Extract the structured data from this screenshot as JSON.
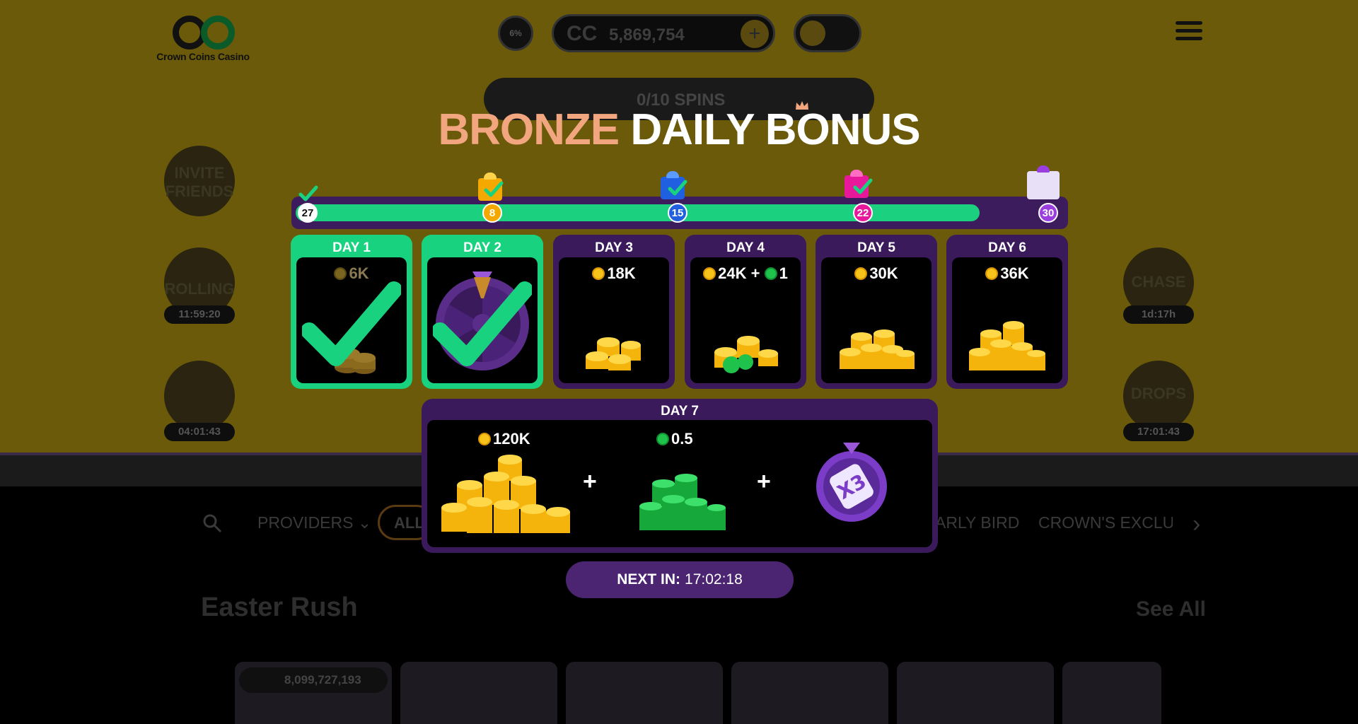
{
  "header": {
    "logo_text": "Crown Coins Casino",
    "progress_pct": "6%",
    "balance_currency": "CC",
    "balance_value": "5,869,754"
  },
  "spins": {
    "label": "0/10 SPINS"
  },
  "side_widgets": [
    {
      "label": "INVITE FRIENDS",
      "timer": ""
    },
    {
      "label": "ROLLING",
      "timer": "11:59:20"
    },
    {
      "label": "",
      "timer": "04:01:43"
    },
    {
      "label": "CHASE",
      "timer": "1d:17h"
    },
    {
      "label": "DROPS",
      "timer": "17:01:43"
    }
  ],
  "filters": {
    "providers": "PROVIDERS",
    "all": "ALL",
    "early_bird": "ARLY BIRD",
    "crowns_exclusive": "CROWN'S EXCLU"
  },
  "section": {
    "title": "Easter Rush",
    "see_all": "See All"
  },
  "jackpot": "8,099,727,193",
  "bonus": {
    "title_tier": "BRONZE",
    "title_rest": "DAILY BONUS",
    "progress": {
      "fill_fraction": 0.89,
      "milestones": [
        "27",
        "8",
        "15",
        "22",
        "30"
      ],
      "milestone_colors": [
        "#ffffff",
        "#f5a900",
        "#1f5fe0",
        "#e8189a",
        "#9a3ee0"
      ]
    },
    "days": [
      {
        "label": "DAY 1",
        "amount": "6K",
        "claimed": true
      },
      {
        "label": "DAY 2",
        "amount": "",
        "claimed": true
      },
      {
        "label": "DAY 3",
        "amount": "18K",
        "claimed": false
      },
      {
        "label": "DAY 4",
        "amount": "24K",
        "amount_plus": "+",
        "amount_sc": "1",
        "claimed": false
      },
      {
        "label": "DAY 5",
        "amount": "30K",
        "claimed": false
      },
      {
        "label": "DAY 6",
        "amount": "36K",
        "claimed": false
      }
    ],
    "day7": {
      "label": "DAY 7",
      "coins": "120K",
      "plus": "+",
      "sweeps": "0.5",
      "multiplier": "X3"
    },
    "next_label": "NEXT IN:",
    "next_time": "17:02:18"
  },
  "colors": {
    "green": "#19d27f",
    "purple": "#3b1a5c",
    "bronze": "#f1a67f"
  }
}
